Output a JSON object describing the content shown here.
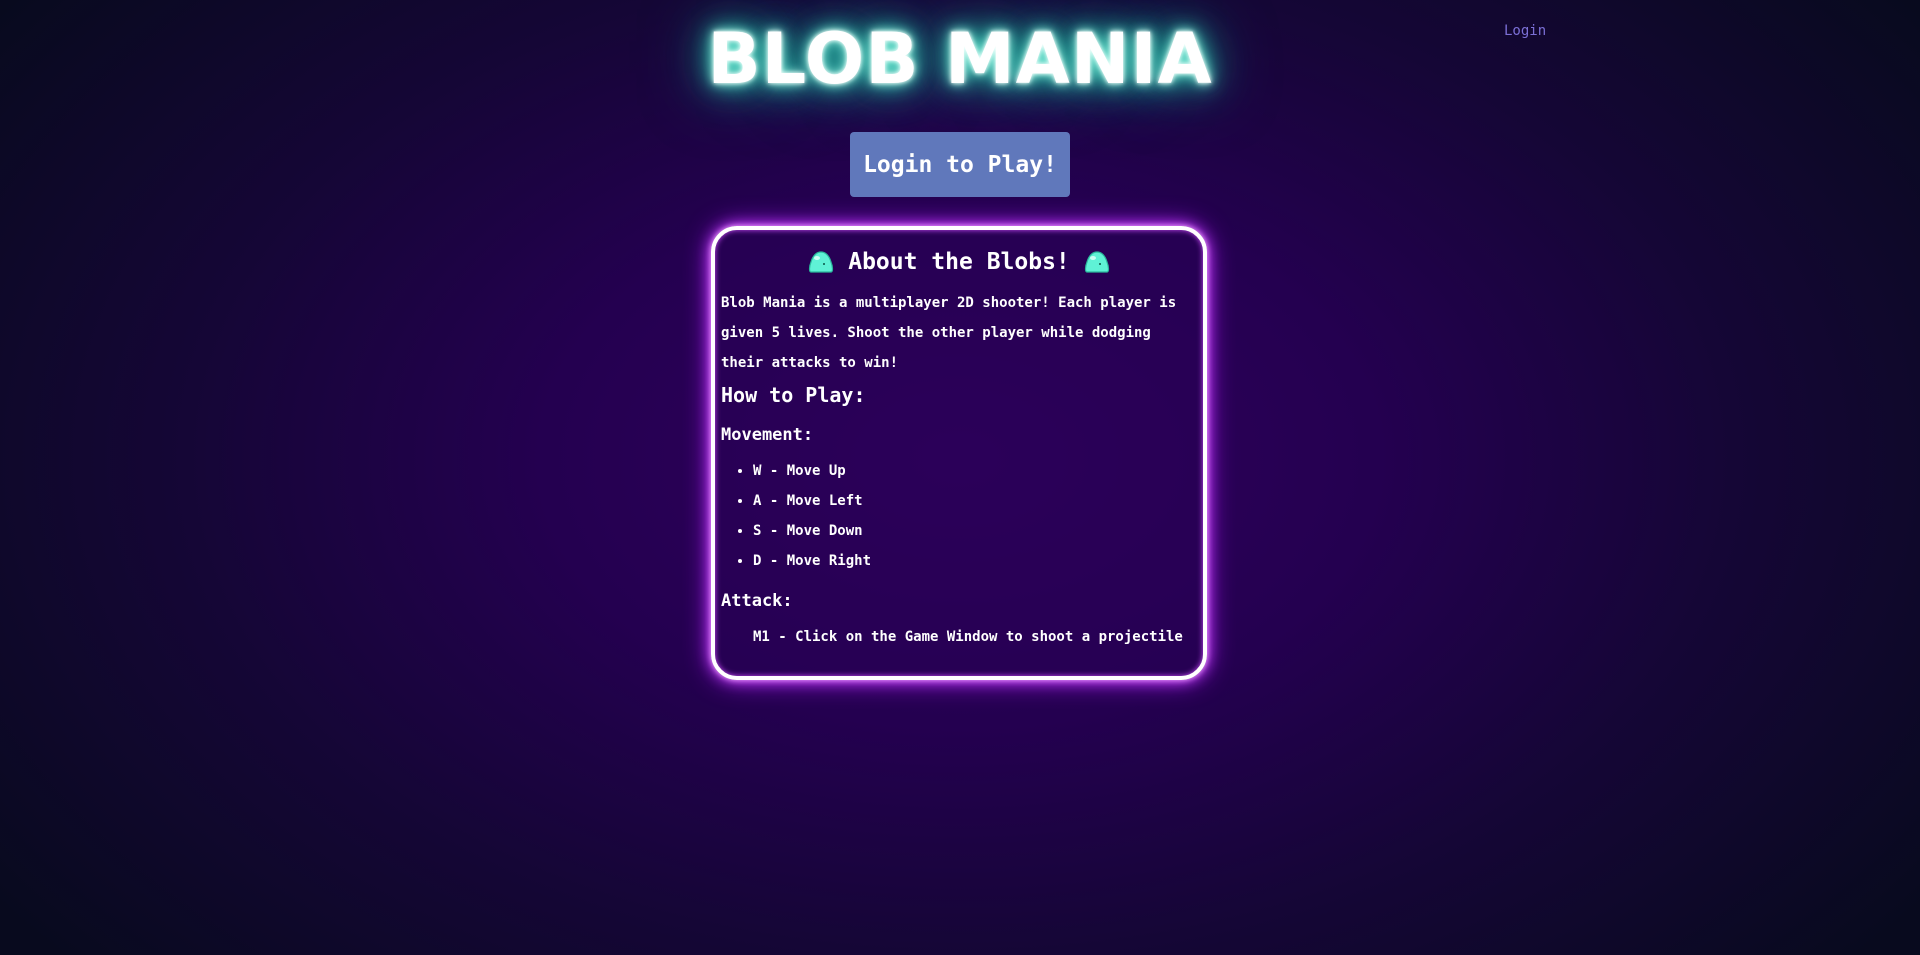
{
  "header": {
    "login_link": "Login",
    "title": "BLOB MANIA"
  },
  "cta": {
    "label": "Login to Play!"
  },
  "about": {
    "heading": "About the Blobs!",
    "blob_icon": "blob-icon",
    "description": "Blob Mania is a multiplayer 2D shooter! Each player is given 5 lives. Shoot the other player while dodging their attacks to win!",
    "how_to_play": "How to Play:",
    "movement_heading": "Movement:",
    "movement_items": [
      "W - Move Up",
      "A - Move Left",
      "S - Move Down",
      "D - Move Right"
    ],
    "attack_heading": "Attack:",
    "attack_text": "M1 - Click on the Game Window to shoot a projectile"
  },
  "colors": {
    "title_glow": "#3fe6c8",
    "card_glow": "#d04cff",
    "button": "#6078bb",
    "login_link": "#7b6fd6",
    "background_center": "#30005e",
    "background_edge": "#080a1e"
  }
}
